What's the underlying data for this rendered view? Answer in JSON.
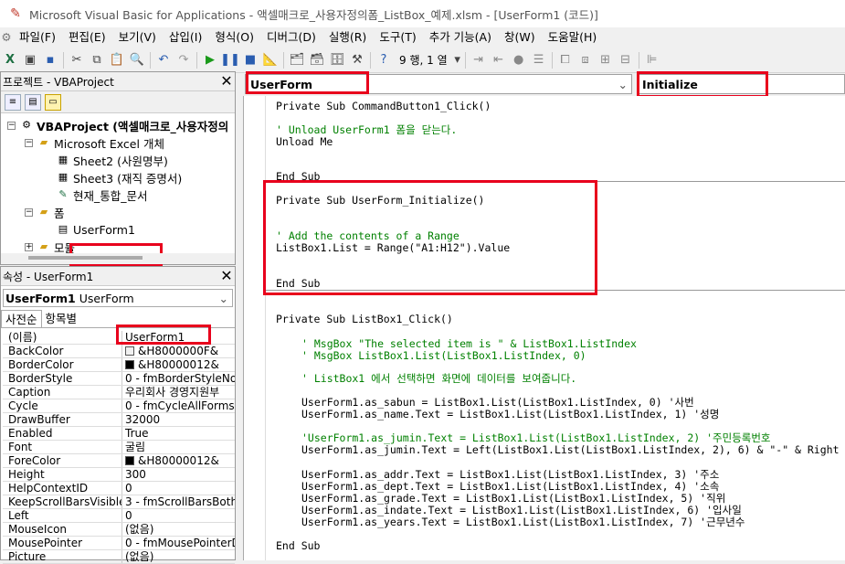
{
  "window": {
    "title": "Microsoft Visual Basic for Applications - 액셀매크로_사용자정의폼_ListBox_예제.xlsm - [UserForm1 (코드)]"
  },
  "menu": [
    "파일(F)",
    "편집(E)",
    "보기(V)",
    "삽입(I)",
    "형식(O)",
    "디버그(D)",
    "실행(R)",
    "도구(T)",
    "추가 기능(A)",
    "창(W)",
    "도움말(H)"
  ],
  "toolbar": {
    "position": "9 행, 1 열"
  },
  "project": {
    "title": "프로젝트 - VBAProject",
    "root": "VBAProject (액셀매크로_사용자정의",
    "excel_objects": "Microsoft Excel 개체",
    "sheet2": "Sheet2 (사원명부)",
    "sheet3": "Sheet3 (재직 증명서)",
    "workbook": "현재_통합_문서",
    "forms": "폼",
    "userform": "UserForm1",
    "modules": "모듈"
  },
  "properties": {
    "title": "속성 - UserForm1",
    "object_bold": "UserForm1",
    "object_type": "UserForm",
    "tab_alpha": "사전순",
    "tab_category": "항목별",
    "rows": [
      {
        "name": "(이름)",
        "value": "UserForm1"
      },
      {
        "name": "BackColor",
        "value": "&H8000000F&",
        "swatch": "#f0f0f0"
      },
      {
        "name": "BorderColor",
        "value": "&H80000012&",
        "swatch": "#000000"
      },
      {
        "name": "BorderStyle",
        "value": "0 - fmBorderStyleNor"
      },
      {
        "name": "Caption",
        "value": "우리회사 경영지원부"
      },
      {
        "name": "Cycle",
        "value": "0 - fmCycleAllForms"
      },
      {
        "name": "DrawBuffer",
        "value": "32000"
      },
      {
        "name": "Enabled",
        "value": "True"
      },
      {
        "name": "Font",
        "value": "굴림"
      },
      {
        "name": "ForeColor",
        "value": "&H80000012&",
        "swatch": "#000000"
      },
      {
        "name": "Height",
        "value": "300"
      },
      {
        "name": "HelpContextID",
        "value": "0"
      },
      {
        "name": "KeepScrollBarsVisible",
        "value": "3 - fmScrollBarsBoth"
      },
      {
        "name": "Left",
        "value": "0"
      },
      {
        "name": "MouseIcon",
        "value": "(없음)"
      },
      {
        "name": "MousePointer",
        "value": "0 - fmMousePointerD"
      },
      {
        "name": "Picture",
        "value": "(없음)"
      }
    ]
  },
  "code": {
    "object_combo": "UserForm",
    "proc_combo": "Initialize",
    "lines": [
      "Private Sub CommandButton1_Click()",
      "' Unload UserForm1 폼을 닫는다.",
      "Unload Me",
      "End Sub",
      "Private Sub UserForm_Initialize()",
      "' Add the contents of a Range",
      "ListBox1.List = Range(\"A1:H12\").Value",
      "End Sub",
      "Private Sub ListBox1_Click()",
      "' MsgBox \"The selected item is \" & ListBox1.ListIndex",
      "' MsgBox ListBox1.List(ListBox1.ListIndex, 0)",
      "' ListBox1 에서 선택하면 화면에 데이터를 보여줍니다.",
      "UserForm1.as_sabun = ListBox1.List(ListBox1.ListIndex, 0) '사번",
      "UserForm1.as_name.Text = ListBox1.List(ListBox1.ListIndex, 1)  '성명",
      "'UserForm1.as_jumin.Text = ListBox1.List(ListBox1.ListIndex, 2) '주민등록번호",
      "UserForm1.as_jumin.Text = Left(ListBox1.List(ListBox1.ListIndex, 2), 6) & \"-\" & Right",
      "UserForm1.as_addr.Text = ListBox1.List(ListBox1.ListIndex, 3) '주소",
      "UserForm1.as_dept.Text = ListBox1.List(ListBox1.ListIndex, 4) '소속",
      "UserForm1.as_grade.Text = ListBox1.List(ListBox1.ListIndex, 5) '직위",
      "UserForm1.as_indate.Text = ListBox1.List(ListBox1.ListIndex, 6) '입사일",
      "UserForm1.as_years.Text = ListBox1.List(ListBox1.ListIndex, 7) '근무년수",
      "End Sub"
    ]
  }
}
